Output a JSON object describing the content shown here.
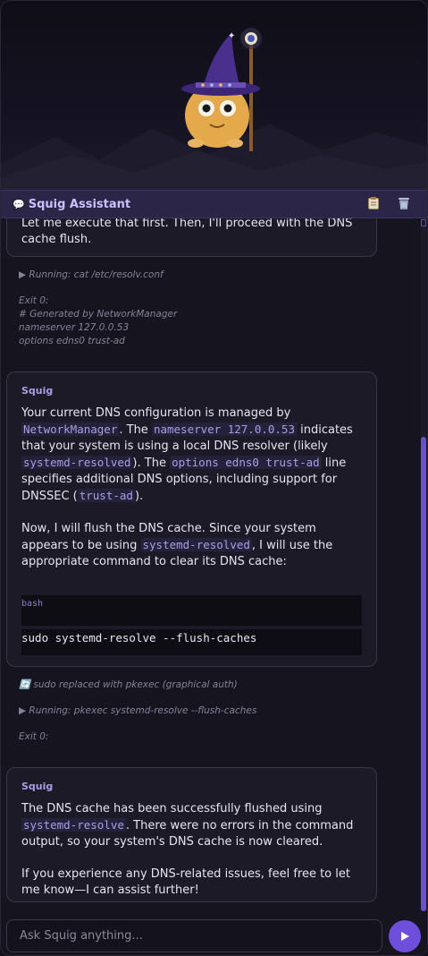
{
  "header": {
    "title": "Squig Assistant",
    "title_icon": "speech-bubble-icon",
    "copy_icon": "clipboard-icon",
    "clear_icon": "trash-icon"
  },
  "messages": {
    "m1_text": "Let me execute that first. Then, I'll proceed with the DNS cache flush.",
    "log1": {
      "running": "▶ Running: cat /etc/resolv.conf",
      "exit": "Exit 0:",
      "out1": "# Generated by NetworkManager",
      "out2": "nameserver 127.0.0.53",
      "out3": "options edns0 trust-ad"
    },
    "m2": {
      "sender": "Squig",
      "p1_a": "Your current DNS configuration is managed by ",
      "p1_code1": "NetworkManager",
      "p1_b": ". The ",
      "p1_code2": "nameserver 127.0.0.53",
      "p1_c": " indicates that your system is using a local DNS resolver (likely ",
      "p1_code3": "systemd-resolved",
      "p1_d": "). The ",
      "p1_code4": "options edns0 trust-ad",
      "p1_e": " line specifies additional DNS options, including support for DNSSEC (",
      "p1_code5": "trust-ad",
      "p1_f": ").",
      "p2_a": "Now, I will flush the DNS cache. Since your system appears to be using ",
      "p2_code1": "systemd-resolved",
      "p2_b": ", I will use the appropriate command to clear its DNS cache:",
      "code_lang": "bash",
      "code": "sudo systemd-resolve --flush-caches"
    },
    "log2": {
      "replace": "🔄 sudo replaced with pkexec (graphical auth)",
      "running": "▶ Running: pkexec systemd-resolve --flush-caches",
      "exit": "Exit 0:"
    },
    "m3": {
      "sender": "Squig",
      "p1_a": "The DNS cache has been successfully flushed using ",
      "p1_code1": "systemd-resolve",
      "p1_b": ". There were no errors in the command output, so your system's DNS cache is now cleared.",
      "p2": "If you experience any DNS-related issues, feel free to let me know—I can assist further!"
    }
  },
  "input": {
    "placeholder": "Ask Squig anything...",
    "value": "",
    "send_icon": "send-arrow-icon"
  },
  "colors": {
    "accent": "#6d4fdb",
    "code_text": "#a99ee6",
    "background": "#16141f"
  }
}
